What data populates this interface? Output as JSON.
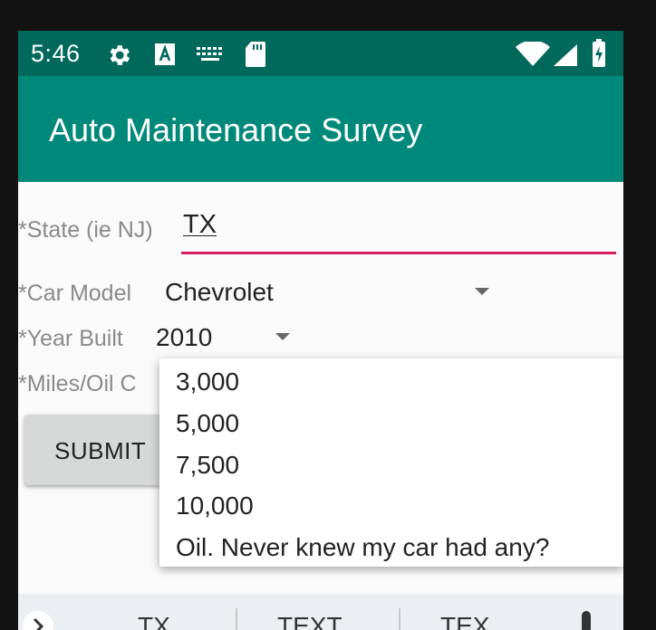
{
  "status_bar": {
    "time": "5:46",
    "icons": [
      "gear-icon",
      "a-keyboard-icon",
      "keyboard-icon",
      "sd-card-icon",
      "wifi-icon",
      "signal-icon",
      "battery-icon"
    ]
  },
  "app_bar": {
    "title": "Auto Maintenance Survey"
  },
  "form": {
    "state": {
      "label": "*State (ie NJ)",
      "value": "TX"
    },
    "car_model": {
      "label": "*Car Model",
      "value": "Chevrolet"
    },
    "year_built": {
      "label": "*Year Built",
      "value": "2010"
    },
    "miles_oil": {
      "label": "*Miles/Oil C"
    },
    "submit_label": "SUBMIT"
  },
  "dropdown": {
    "options": [
      "3,000",
      "5,000",
      "7,500",
      "10,000",
      "Oil. Never knew my car had any?"
    ]
  },
  "keyboard_suggestions": [
    "TX",
    "TEXT",
    "TEX"
  ],
  "colors": {
    "status_bar": "#00695c",
    "app_bar": "#00897b",
    "accent_underline": "#d81b60"
  }
}
